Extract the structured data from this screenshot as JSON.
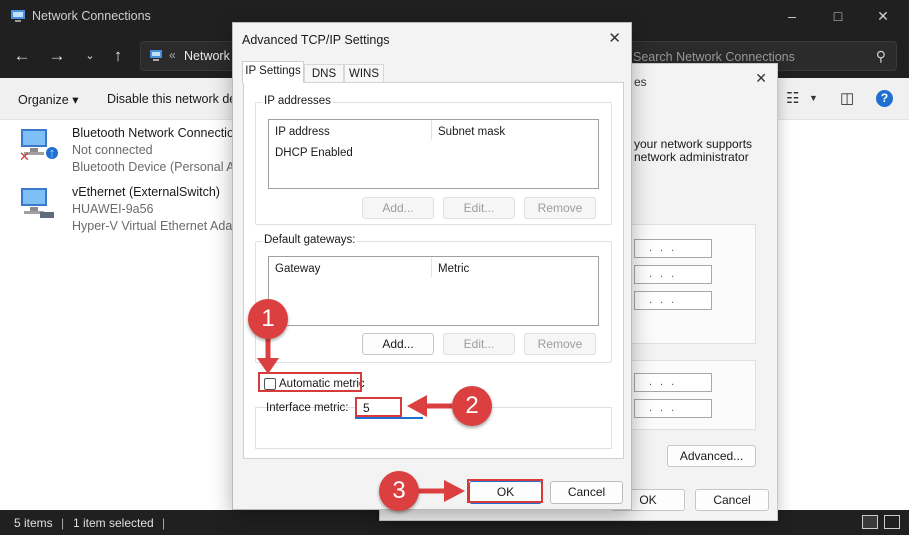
{
  "explorer": {
    "window_title": "Network Connections",
    "address_crumb": "Network",
    "address_sep": "«",
    "search_placeholder": "Search Network Connections",
    "commands": {
      "organize": "Organize ▾",
      "disable": "Disable this network de"
    },
    "items": [
      {
        "name": "Bluetooth Network Connection",
        "status": "Not connected",
        "device": "Bluetooth Device (Personal Are"
      },
      {
        "name": "vEthernet (ExternalSwitch)",
        "status": "HUAWEI-9a56",
        "device": "Hyper-V Virtual Ethernet Adap"
      }
    ],
    "status": {
      "count": "5 items",
      "selected": "1 item selected"
    }
  },
  "properties_dialog": {
    "title_fragment": "es",
    "line1": "your network supports",
    "line2": "network administrator",
    "advanced_label": "Advanced...",
    "ok_label": "OK",
    "cancel_label": "Cancel"
  },
  "advanced_dialog": {
    "title": "Advanced TCP/IP Settings",
    "tabs": [
      "IP Settings",
      "DNS",
      "WINS"
    ],
    "ip_addresses": {
      "legend": "IP addresses",
      "columns": [
        "IP address",
        "Subnet mask"
      ],
      "rows": [
        "DHCP Enabled"
      ],
      "buttons": {
        "add": "Add...",
        "edit": "Edit...",
        "remove": "Remove"
      }
    },
    "gateways": {
      "legend": "Default gateways:",
      "columns": [
        "Gateway",
        "Metric"
      ],
      "buttons": {
        "add": "Add...",
        "edit": "Edit...",
        "remove": "Remove"
      }
    },
    "automatic_metric_label": "Automatic metric",
    "interface_metric_label": "Interface metric:",
    "interface_metric_value": "5",
    "ok_label": "OK",
    "cancel_label": "Cancel"
  },
  "annotations": {
    "step1": "1",
    "step2": "2",
    "step3": "3",
    "color": "#dc3f3f"
  }
}
